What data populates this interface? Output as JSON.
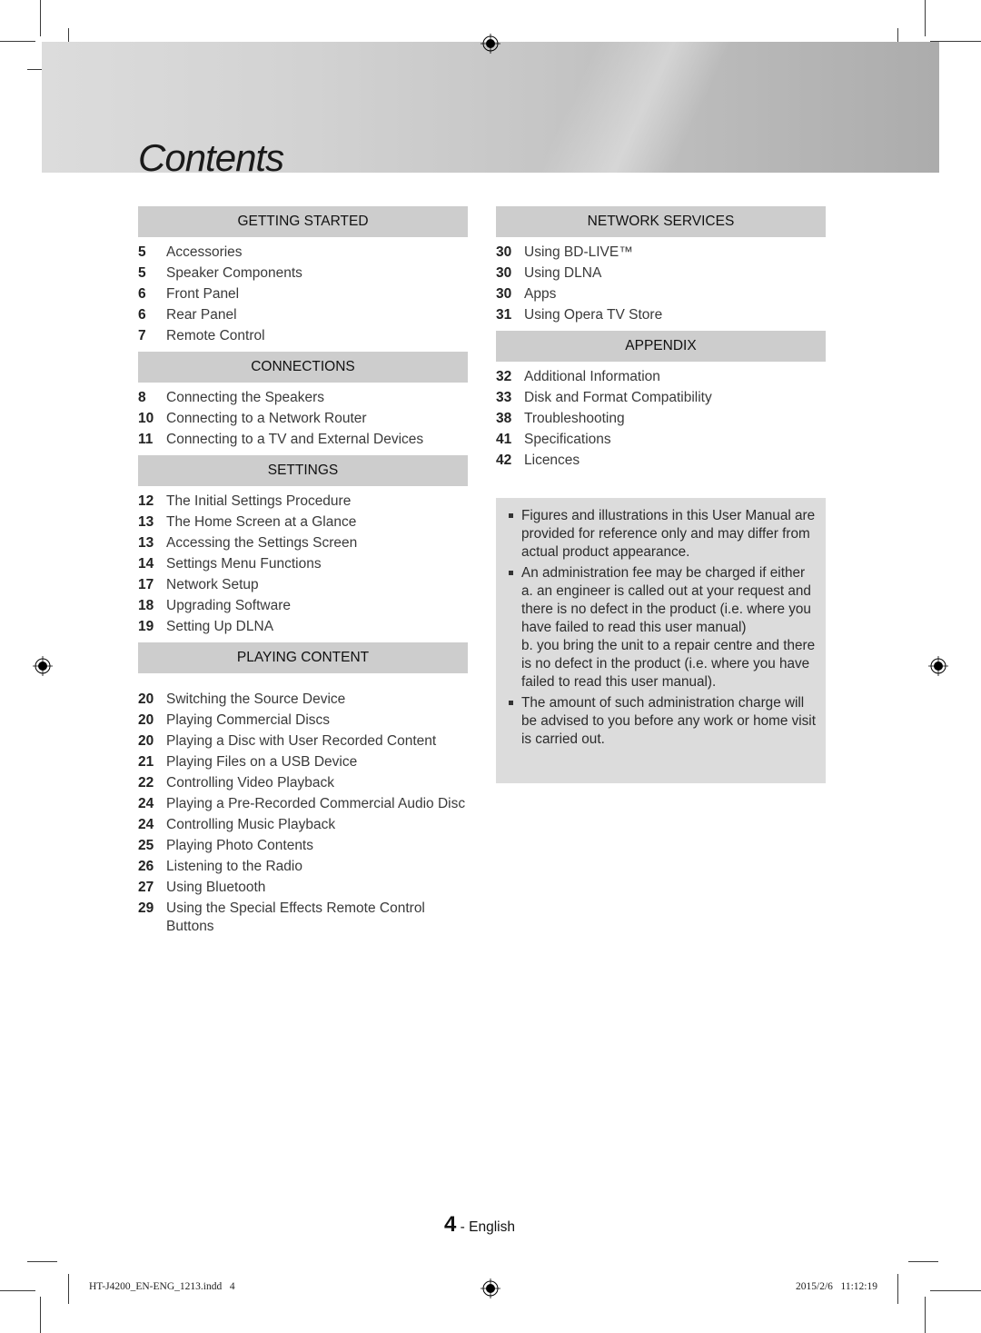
{
  "page": {
    "title": "Contents",
    "page_number": "4",
    "page_language": "- English",
    "footer_file": "HT-J4200_EN-ENG_1213.indd   4",
    "footer_datetime": "2015/2/6   11:12:19"
  },
  "colors": {
    "section_header_bg": "#cdcdcd",
    "note_box_bg": "#dcdcdc",
    "text": "#231f20"
  },
  "left_column": [
    {
      "heading": "GETTING STARTED",
      "entries": [
        {
          "page": "5",
          "label": "Accessories"
        },
        {
          "page": "5",
          "label": "Speaker Components"
        },
        {
          "page": "6",
          "label": "Front Panel"
        },
        {
          "page": "6",
          "label": "Rear Panel"
        },
        {
          "page": "7",
          "label": "Remote Control"
        }
      ]
    },
    {
      "heading": "CONNECTIONS",
      "entries": [
        {
          "page": "8",
          "label": "Connecting the Speakers"
        },
        {
          "page": "10",
          "label": "Connecting to a Network Router"
        },
        {
          "page": "11",
          "label": "Connecting to a TV and External Devices"
        }
      ]
    },
    {
      "heading": "SETTINGS",
      "entries": [
        {
          "page": "12",
          "label": "The Initial Settings Procedure"
        },
        {
          "page": "13",
          "label": "The Home Screen at a Glance"
        },
        {
          "page": "13",
          "label": "Accessing the Settings Screen"
        },
        {
          "page": "14",
          "label": "Settings Menu Functions"
        },
        {
          "page": "17",
          "label": "Network Setup"
        },
        {
          "page": "18",
          "label": "Upgrading Software"
        },
        {
          "page": "19",
          "label": "Setting Up DLNA"
        }
      ]
    },
    {
      "heading": "PLAYING CONTENT",
      "entries": [
        {
          "page": "20",
          "label": "Switching the Source Device"
        },
        {
          "page": "20",
          "label": "Playing Commercial Discs"
        },
        {
          "page": "20",
          "label": "Playing a Disc with User Recorded Content"
        },
        {
          "page": "21",
          "label": "Playing Files on a USB Device"
        },
        {
          "page": "22",
          "label": "Controlling Video Playback"
        },
        {
          "page": "24",
          "label": "Playing a Pre-Recorded Commercial Audio Disc"
        },
        {
          "page": "24",
          "label": "Controlling Music Playback"
        },
        {
          "page": "25",
          "label": "Playing Photo Contents"
        },
        {
          "page": "26",
          "label": "Listening to the Radio"
        },
        {
          "page": "27",
          "label": "Using Bluetooth"
        },
        {
          "page": "29",
          "label": "Using the Special Effects Remote Control Buttons"
        }
      ]
    }
  ],
  "right_column": [
    {
      "heading": "NETWORK SERVICES",
      "entries": [
        {
          "page": "30",
          "label": "Using BD-LIVE™"
        },
        {
          "page": "30",
          "label": "Using DLNA"
        },
        {
          "page": "30",
          "label": "Apps"
        },
        {
          "page": "31",
          "label": "Using Opera TV Store"
        }
      ]
    },
    {
      "heading": "APPENDIX",
      "entries": [
        {
          "page": "32",
          "label": "Additional Information"
        },
        {
          "page": "33",
          "label": "Disk and Format Compatibility"
        },
        {
          "page": "38",
          "label": "Troubleshooting"
        },
        {
          "page": "41",
          "label": "Specifications"
        },
        {
          "page": "42",
          "label": "Licences"
        }
      ]
    }
  ],
  "notes": [
    "Figures and illustrations in this User Manual are provided for reference only and may differ from actual product appearance.",
    "An administration fee may be charged if either\na. an engineer is called out at your request and there is no defect in the product (i.e. where you have failed to read this user manual)\nb. you bring the unit to a repair centre and there is no defect in the product (i.e. where you have failed to read this user manual).",
    "The amount of such administration charge will be advised to you before any work or home visit is carried out."
  ]
}
